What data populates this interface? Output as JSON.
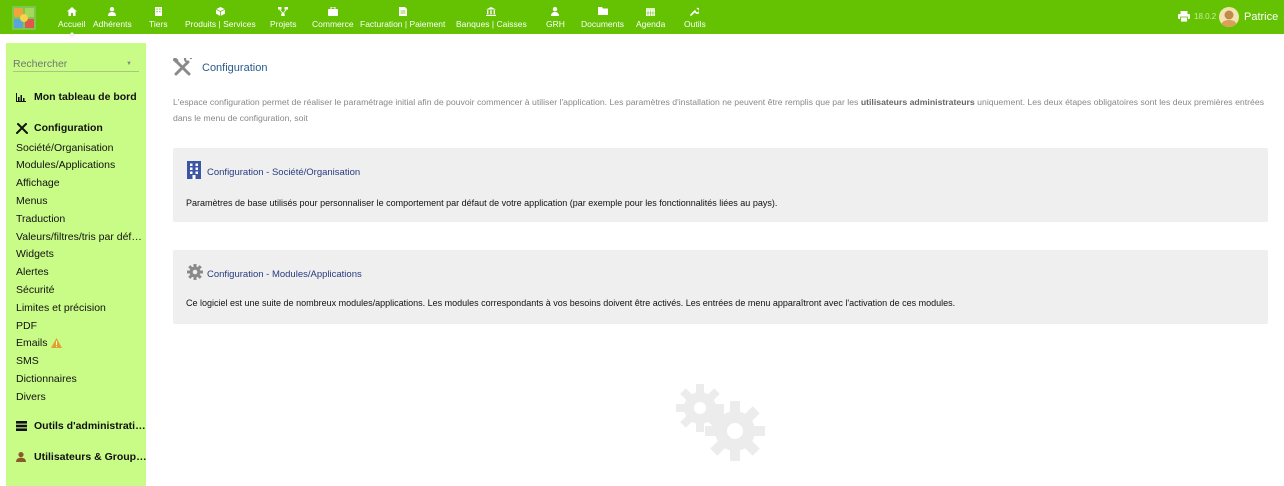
{
  "topbar": {
    "menu": [
      {
        "label": "Accueil",
        "icon": "home-icon"
      },
      {
        "label": "Adhérents",
        "icon": "member-icon"
      },
      {
        "label": "Tiers",
        "icon": "building-icon"
      },
      {
        "label": "Produits | Services",
        "icon": "cube-icon"
      },
      {
        "label": "Projets",
        "icon": "project-icon"
      },
      {
        "label": "Commerce",
        "icon": "briefcase-icon"
      },
      {
        "label": "Facturation | Paiement",
        "icon": "invoice-icon"
      },
      {
        "label": "Banques | Caisses",
        "icon": "bank-icon"
      },
      {
        "label": "GRH",
        "icon": "hr-icon"
      },
      {
        "label": "Documents",
        "icon": "folder-icon"
      },
      {
        "label": "Agenda",
        "icon": "calendar-icon"
      },
      {
        "label": "Outils",
        "icon": "wrench-icon"
      }
    ],
    "active": "Accueil",
    "version": "18.0.2",
    "user": "Patrice",
    "color": "#64c203"
  },
  "sidebar": {
    "search_placeholder": "Rechercher",
    "dashboard": "Mon tableau de bord",
    "config_heading": "Configuration",
    "items": [
      "Société/Organisation",
      "Modules/Applications",
      "Affichage",
      "Menus",
      "Traduction",
      "Valeurs/filtres/tris par déf…",
      "Widgets",
      "Alertes",
      "Sécurité",
      "Limites et précision",
      "PDF",
      "Emails",
      "SMS",
      "Dictionnaires",
      "Divers"
    ],
    "admin_tools": "Outils d'administrati…",
    "users_groups": "Utilisateurs & Group…",
    "color": "#c9fb87"
  },
  "main": {
    "title": "Configuration",
    "intro_part1": "L'espace configuration permet de réaliser le paramétrage initial afin de pouvoir commencer à utiliser l'application. Les paramètres d'installation ne peuvent être remplis que par les ",
    "intro_bold": "utilisateurs administrateurs",
    "intro_part2": " uniquement. Les deux étapes obligatoires sont les deux premières entrées dans le menu de configuration, soit",
    "cards": [
      {
        "title": "Configuration - Société/Organisation",
        "desc": "Paramètres de base utilisés pour personnaliser le comportement par défaut de votre application (par exemple pour les fonctionnalités liées au pays)."
      },
      {
        "title": "Configuration - Modules/Applications",
        "desc": "Ce logiciel est une suite de nombreux modules/applications. Les modules correspondants à vos besoins doivent être activés. Les entrées de menu apparaîtront avec l'activation de ces modules."
      }
    ]
  }
}
